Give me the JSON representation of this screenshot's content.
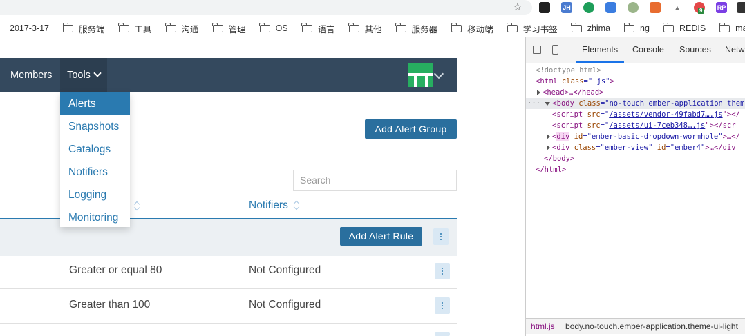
{
  "browser": {
    "bookmarks": [
      "2017-3-17",
      "服务端",
      "工具",
      "沟通",
      "管理",
      "OS",
      "语言",
      "其他",
      "服务器",
      "移动端",
      "学习书签",
      "zhima",
      "ng",
      "REDIS",
      "mac"
    ],
    "extension_badge": "9",
    "extension_labels": [
      "JH",
      "RP"
    ]
  },
  "navbar": {
    "members_label": "Members",
    "tools_label": "Tools"
  },
  "tools_menu": {
    "items": [
      "Alerts",
      "Snapshots",
      "Catalogs",
      "Notifiers",
      "Logging",
      "Monitoring"
    ],
    "active": "Alerts"
  },
  "main": {
    "add_group_label": "Add Alert Group",
    "search_placeholder": "Search",
    "column_notifiers": "Notifiers",
    "add_rule_label": "Add Alert Rule",
    "rows": [
      {
        "condition": "Greater or equal 80",
        "notifiers": "Not Configured"
      },
      {
        "condition": "Greater than 100",
        "notifiers": "Not Configured"
      }
    ]
  },
  "devtools": {
    "tabs": [
      "Elements",
      "Console",
      "Sources",
      "Netw"
    ],
    "active_tab": "Elements",
    "lines": {
      "l0": "<!doctype html>",
      "l1_tag": "<html",
      "l1_attr": " class",
      "l1_val": "=\" js\"",
      "l1_end": ">",
      "l2": "<head>…</head>",
      "l3_tag": "<body",
      "l3_attr": " class",
      "l3_val": "=\"no-touch ember-application them",
      "l4_tag": "<script",
      "l4_attr": " src",
      "l4_link": "/assets/vendor-49fabd7….js",
      "l4_end": "\"></",
      "l5_tag": "<script",
      "l5_attr": " src",
      "l5_link": "/assets/ui-7ceb348….js",
      "l5_end": "\"></scr",
      "l6_tag": "div",
      "l6_attr": " id",
      "l6_val": "=\"ember-basic-dropdown-wormhole\"",
      "l6_end": ">…</",
      "l7_tag": "<div",
      "l7_attr": " class",
      "l7_val": "=\"ember-view\"",
      "l7_attr2": " id",
      "l7_val2": "=\"ember4\"",
      "l7_end": ">…</div",
      "l8": "</body>",
      "l9": "</html>"
    },
    "breadcrumb": [
      "html.js",
      "body.no-touch.ember-application.theme-ui-light"
    ]
  }
}
